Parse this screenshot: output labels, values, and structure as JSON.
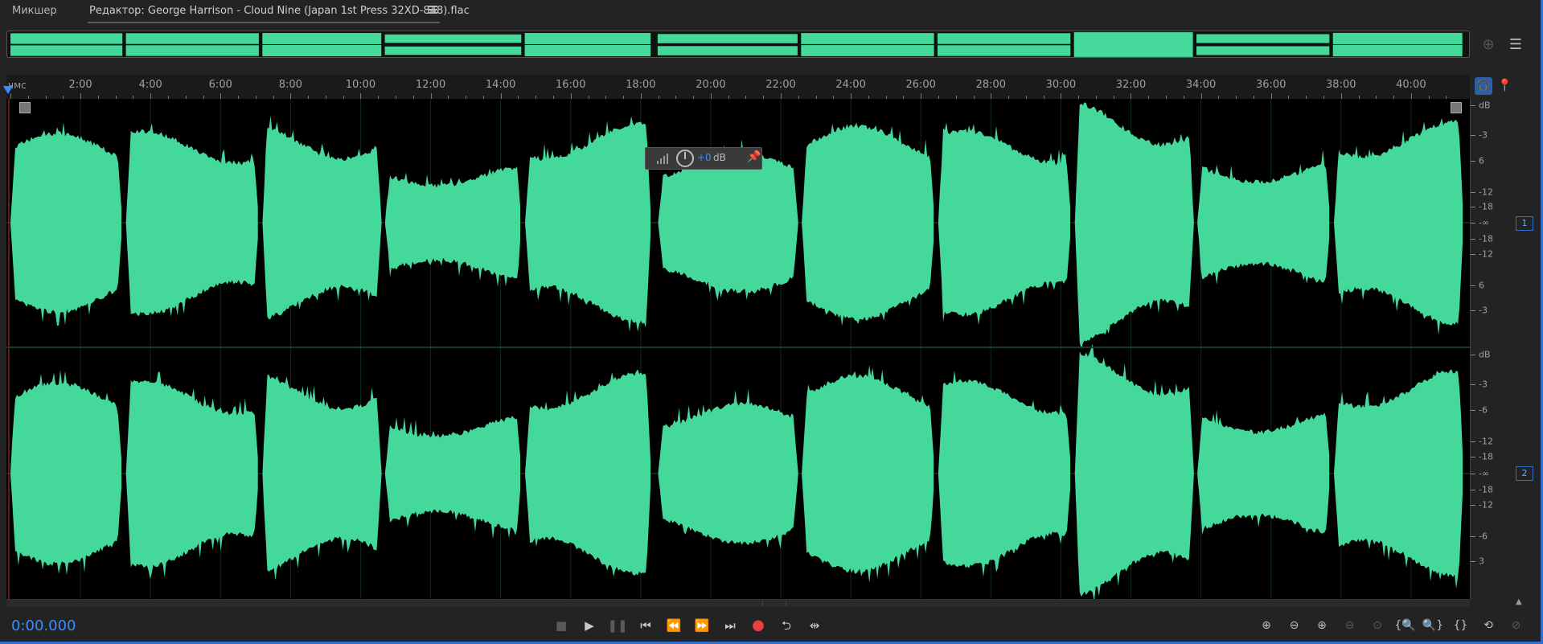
{
  "tabs": {
    "mixer_label": "Микшер",
    "editor_label": "Редактор: George Harrison - Cloud Nine (Japan 1st Press 32XD-848).flac",
    "menu_icon": "hamburger-icon"
  },
  "ruler": {
    "unit": "чмс",
    "ticks": [
      "2:00",
      "4:00",
      "6:00",
      "8:00",
      "10:00",
      "12:00",
      "14:00",
      "16:00",
      "18:00",
      "20:00",
      "22:00",
      "24:00",
      "26:00",
      "28:00",
      "30:00",
      "32:00",
      "34:00",
      "36:00",
      "38:00",
      "40:00"
    ]
  },
  "hud": {
    "value": "+0",
    "unit": "dB"
  },
  "db_scale": {
    "channel1_labels": [
      "dB",
      "-3",
      "6",
      "-12",
      "-18",
      "-∞",
      "-18",
      "-12",
      "6",
      "-3"
    ],
    "channel2_labels": [
      "dB",
      "-3",
      "-6",
      "-12",
      "-18",
      "-∞",
      "-18",
      "-12",
      "-6",
      "3"
    ],
    "channel1_badge": "1",
    "channel2_badge": "2"
  },
  "waveform": {
    "color": "#44d99a",
    "tracks_minutes": [
      {
        "start": 0.0,
        "end": 3.2,
        "level": 0.72
      },
      {
        "start": 3.3,
        "end": 7.1,
        "level": 0.74
      },
      {
        "start": 7.2,
        "end": 10.6,
        "level": 0.8
      },
      {
        "start": 10.7,
        "end": 14.6,
        "level": 0.45
      },
      {
        "start": 14.7,
        "end": 18.3,
        "level": 0.8
      },
      {
        "start": 18.5,
        "end": 22.5,
        "level": 0.55
      },
      {
        "start": 22.6,
        "end": 26.4,
        "level": 0.78
      },
      {
        "start": 26.5,
        "end": 30.3,
        "level": 0.74
      },
      {
        "start": 30.4,
        "end": 33.8,
        "level": 0.98
      },
      {
        "start": 33.9,
        "end": 37.7,
        "level": 0.5
      },
      {
        "start": 37.8,
        "end": 41.5,
        "level": 0.82
      }
    ],
    "total_minutes": 41.6
  },
  "transport": {
    "timecode": "0:00.000",
    "buttons": [
      {
        "name": "stop-button",
        "glyph": "■",
        "dim": true
      },
      {
        "name": "play-button",
        "glyph": "▶",
        "dim": false
      },
      {
        "name": "pause-button",
        "glyph": "❚❚",
        "dim": true
      },
      {
        "name": "go-to-start-button",
        "glyph": "⏮",
        "dim": false
      },
      {
        "name": "rewind-button",
        "glyph": "⏪",
        "dim": false
      },
      {
        "name": "fast-forward-button",
        "glyph": "⏩",
        "dim": false
      },
      {
        "name": "go-to-end-button",
        "glyph": "⏭",
        "dim": false
      },
      {
        "name": "record-button",
        "glyph": "●",
        "dim": false
      },
      {
        "name": "loop-button",
        "glyph": "⮌",
        "dim": false
      },
      {
        "name": "skip-selection-button",
        "glyph": "⇹",
        "dim": false
      }
    ]
  },
  "zoom_tools": [
    {
      "name": "zoom-in-amplitude-icon",
      "glyph": "⊕",
      "dim": false
    },
    {
      "name": "zoom-out-amplitude-icon",
      "glyph": "⊖",
      "dim": false
    },
    {
      "name": "zoom-in-time-icon",
      "glyph": "⊕",
      "dim": false
    },
    {
      "name": "zoom-out-time-icon",
      "glyph": "⊖",
      "dim": true
    },
    {
      "name": "zoom-out-full-icon",
      "glyph": "⊙",
      "dim": true
    },
    {
      "name": "zoom-in-left-icon",
      "glyph": "{🔍",
      "dim": false
    },
    {
      "name": "zoom-in-right-icon",
      "glyph": "🔍}",
      "dim": false
    },
    {
      "name": "zoom-selection-icon",
      "glyph": "{}",
      "dim": false
    },
    {
      "name": "zoom-reset-icon",
      "glyph": "⟲",
      "dim": false
    },
    {
      "name": "zoom-playhead-icon",
      "glyph": "⊘",
      "dim": true
    }
  ]
}
